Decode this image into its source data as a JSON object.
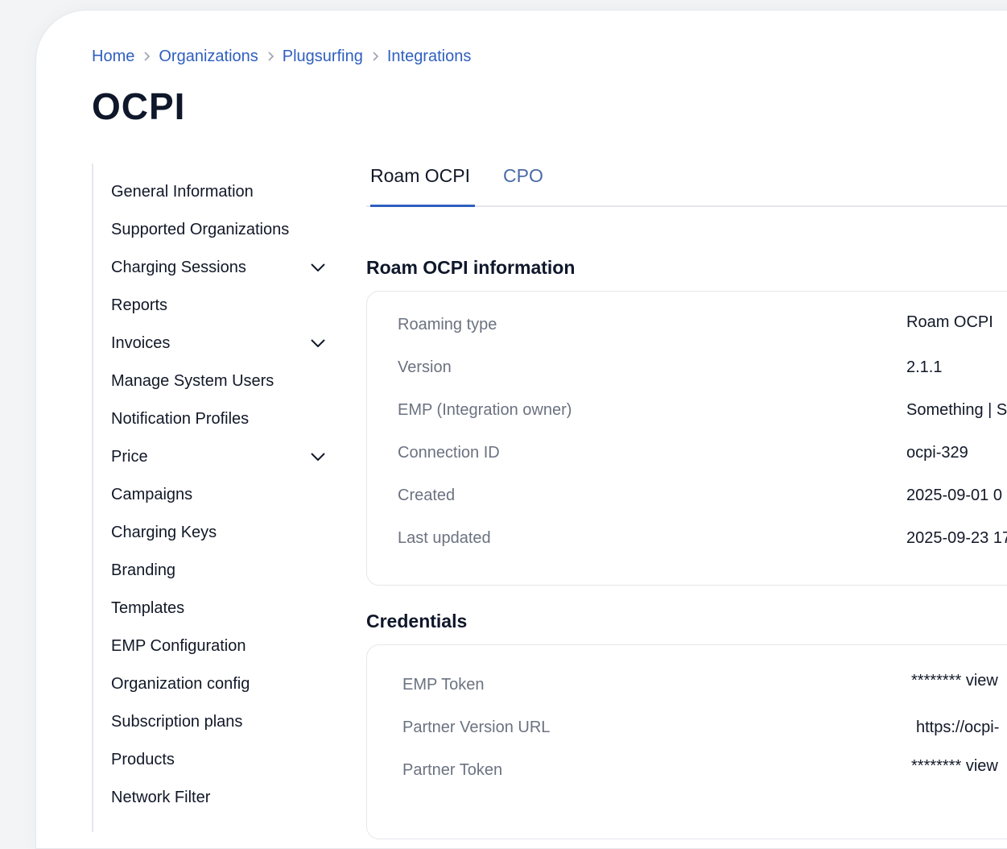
{
  "breadcrumb": [
    "Home",
    "Organizations",
    "Plugsurfing",
    "Integrations"
  ],
  "page_title": "OCPI",
  "sidebar": {
    "items": [
      {
        "label": "General Information",
        "expandable": false
      },
      {
        "label": "Supported Organizations",
        "expandable": false
      },
      {
        "label": "Charging Sessions",
        "expandable": true
      },
      {
        "label": "Reports",
        "expandable": false
      },
      {
        "label": "Invoices",
        "expandable": true
      },
      {
        "label": "Manage System Users",
        "expandable": false
      },
      {
        "label": "Notification Profiles",
        "expandable": false
      },
      {
        "label": "Price",
        "expandable": true
      },
      {
        "label": "Campaigns",
        "expandable": false
      },
      {
        "label": "Charging Keys",
        "expandable": false
      },
      {
        "label": "Branding",
        "expandable": false
      },
      {
        "label": "Templates",
        "expandable": false
      },
      {
        "label": "EMP Configuration",
        "expandable": false
      },
      {
        "label": "Organization config",
        "expandable": false
      },
      {
        "label": "Subscription plans",
        "expandable": false
      },
      {
        "label": "Products",
        "expandable": false
      },
      {
        "label": "Network Filter",
        "expandable": false
      }
    ]
  },
  "tabs": [
    {
      "label": "Roam OCPI",
      "active": true
    },
    {
      "label": "CPO",
      "active": false
    }
  ],
  "info_section": {
    "title": "Roam OCPI information",
    "rows": [
      {
        "label": "Roaming type",
        "value": "Roam OCPI"
      },
      {
        "label": "Version",
        "value": "2.1.1"
      },
      {
        "label": "EMP (Integration owner)",
        "value": "Something | S"
      },
      {
        "label": "Connection ID",
        "value": "ocpi-329"
      },
      {
        "label": "Created",
        "value": "2025-09-01 0"
      },
      {
        "label": "Last updated",
        "value": "2025-09-23 17"
      }
    ]
  },
  "credentials_section": {
    "title": "Credentials",
    "rows": [
      {
        "label": "EMP Token",
        "value": "******** view"
      },
      {
        "label": "Partner Version URL",
        "value": "https://ocpi-"
      },
      {
        "label": "Partner Token",
        "value": "******** view"
      }
    ]
  },
  "colors": {
    "link": "#2f5fbf",
    "tab_underline": "#2f5fbf",
    "label_gray": "#6b7280",
    "border": "#e5e7eb"
  }
}
